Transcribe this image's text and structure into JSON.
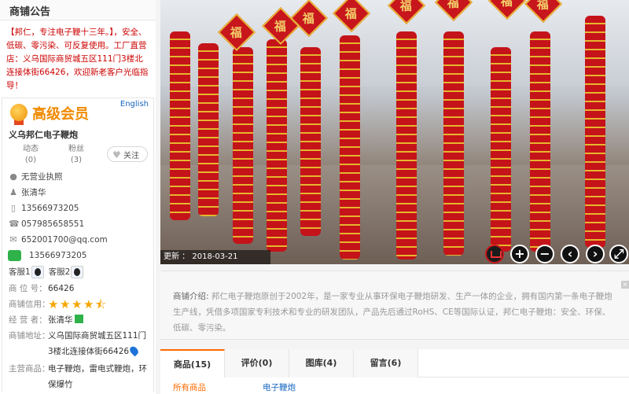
{
  "notice": {
    "title": "商铺公告",
    "body": "【邦仁，专注电子鞭十三年。】，安全、低碳、零污染、可反复使用。工厂直营店：义乌国际商贸城五区111门3楼北连接体街66426，欢迎新老客户光临指导！"
  },
  "card": {
    "member_level": "高级会员",
    "english_link": "English",
    "shop_name": "义乌邦仁电子鞭炮",
    "stats": [
      {
        "label": "动态",
        "value": "(0)"
      },
      {
        "label": "粉丝",
        "value": "(3)"
      }
    ],
    "follow_label": "关注"
  },
  "info": {
    "license": "无营业执照",
    "contact_name": "张清华",
    "mobile": "13566973205",
    "phone": "057985658551",
    "email": "652001700@qq.com",
    "wechat": "13566973205",
    "kefu1": "客服1",
    "kefu2": "客服2",
    "booth_label": "商 位 号：",
    "booth": "66426",
    "credit_label": "商铺信用：",
    "credit_rating": 4.5,
    "operator_label": "经 营 者：",
    "operator": "张清华",
    "address_label": "商铺地址：",
    "address": "义乌国际商贸城五区111门3楼北连接体街66426",
    "goods_label": "主营商品：",
    "goods": "电子鞭炮，雷电式鞭炮，环保爆竹"
  },
  "photo": {
    "update_label": "更新 ：",
    "update_date": "2018-03-21",
    "fu_char": "福",
    "controls": [
      "+",
      "−",
      "‹",
      "›",
      "⤢"
    ]
  },
  "intro": {
    "heading": "商铺介绍:",
    "text": "邦仁电子鞭炮原创于2002年，是一家专业从事环保电子鞭炮研发、生产一体的企业，拥有国内第一条电子鞭炮生产线，凭借多项国家专利技术和专业的研发团队，产品先后通过RoHS、CE等国际认证，邦仁电子鞭炮：安全、环保、低碳、零污染。"
  },
  "tabs": [
    {
      "label": "商品(15)",
      "active": true
    },
    {
      "label": "评价(0)",
      "active": false
    },
    {
      "label": "图库(4)",
      "active": false
    },
    {
      "label": "留言(6)",
      "active": false
    }
  ],
  "subnav": {
    "all": "所有商品",
    "category": "电子鞭炮"
  },
  "colors": {
    "accent": "#ff6a00",
    "notice_red": "#cc0000",
    "member_orange": "#f08a00",
    "link_blue": "#1565c0"
  }
}
